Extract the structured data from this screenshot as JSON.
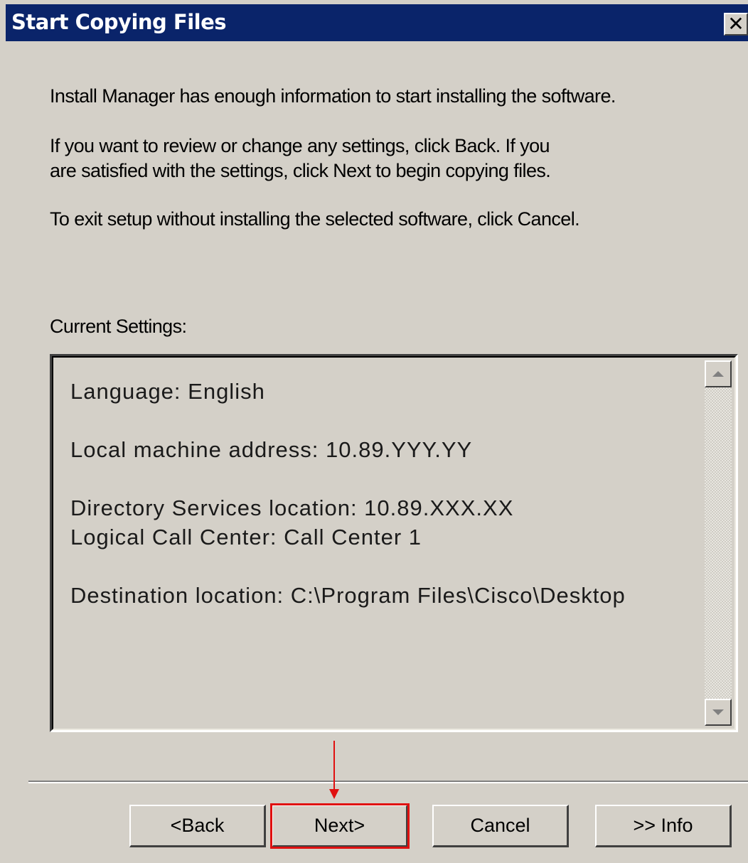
{
  "window": {
    "title": "Start Copying Files",
    "close_label": "✕",
    "title_bar_color": "#0a246a"
  },
  "intro": {
    "line1": "Install Manager has enough information to start installing the software.",
    "line2a": "If you want to review or change any settings, click Back. If you",
    "line2b": "are satisfied with the settings, click Next to begin copying files.",
    "line3": "To exit setup without installing the selected software, click Cancel."
  },
  "settings": {
    "label": "Current Settings:",
    "items": [
      "Language: English",
      "Local machine address:  10.89.YYY.YY",
      "Directory Services location: 10.89.XXX.XX",
      "Logical Call Center: Call Center 1",
      "Destination location: C:\\Program Files\\Cisco\\Desktop"
    ]
  },
  "buttons": {
    "back": "<Back",
    "next": "Next>",
    "cancel": "Cancel",
    "info": ">> Info"
  },
  "annotation": {
    "highlight_color": "#e01010",
    "target": "next"
  }
}
